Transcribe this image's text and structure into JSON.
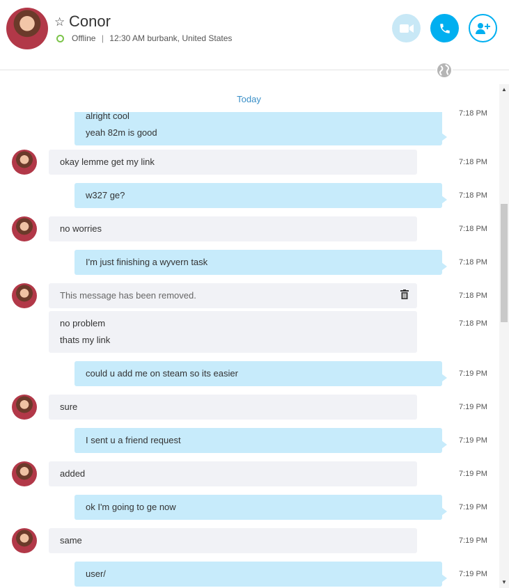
{
  "contact": {
    "name": "Conor",
    "status": "Offline",
    "location": "12:30 AM burbank, United States",
    "separator": "|"
  },
  "header_buttons": {
    "video": "video-call",
    "call": "voice-call",
    "add": "add-people"
  },
  "colors": {
    "accent": "#00aff0",
    "incoming_bubble": "#f1f2f6",
    "outgoing_bubble": "#c7ebfb",
    "online_ring": "#7cc44a"
  },
  "day_label": "Today",
  "messages": [
    {
      "dir": "out",
      "lines": [
        "alright cool",
        "yeah 82m is good"
      ],
      "time": "7:18 PM"
    },
    {
      "dir": "in",
      "lines": [
        "okay lemme get my link"
      ],
      "time": "7:18 PM"
    },
    {
      "dir": "out",
      "lines": [
        "w327 ge?"
      ],
      "time": "7:18 PM"
    },
    {
      "dir": "in",
      "lines": [
        "no worries"
      ],
      "time": "7:18 PM"
    },
    {
      "dir": "out",
      "lines": [
        "I'm just finishing a wyvern task"
      ],
      "time": "7:18 PM"
    },
    {
      "dir": "in",
      "lines": [
        "This message has been removed."
      ],
      "time": "7:18 PM",
      "removed": true
    },
    {
      "dir": "in",
      "lines": [
        "no problem",
        "thats my link"
      ],
      "time": "7:18 PM"
    },
    {
      "dir": "out",
      "lines": [
        "could u add me on steam so its easier"
      ],
      "time": "7:19 PM"
    },
    {
      "dir": "in",
      "lines": [
        "sure"
      ],
      "time": "7:19 PM"
    },
    {
      "dir": "out",
      "lines": [
        "I sent u a friend request"
      ],
      "time": "7:19 PM"
    },
    {
      "dir": "in",
      "lines": [
        "added"
      ],
      "time": "7:19 PM"
    },
    {
      "dir": "out",
      "lines": [
        "ok I'm going to ge now"
      ],
      "time": "7:19 PM"
    },
    {
      "dir": "in",
      "lines": [
        "same"
      ],
      "time": "7:19 PM"
    },
    {
      "dir": "out",
      "lines": [
        "user/"
      ],
      "time": "7:19 PM"
    }
  ]
}
